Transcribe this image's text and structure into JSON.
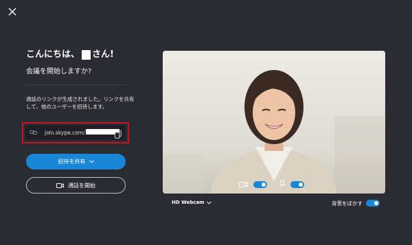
{
  "window": {
    "close_icon": "close-icon"
  },
  "greeting": {
    "prefix": "こんにちは、",
    "suffix": "さん!"
  },
  "subtitle": "会議を開始しますか?",
  "link_info": "通話のリンクが生成されました。リンクを共有して、他のユーザーを招待します。",
  "meeting_link": {
    "text": "join.skype.com/"
  },
  "buttons": {
    "invite": "招待を共有",
    "start_call": "通話を開始"
  },
  "video": {
    "camera_toggle": true,
    "mic_toggle": true
  },
  "camera_select": {
    "selected": "HD Webcam"
  },
  "background_blur": {
    "label": "背景をぼかす",
    "enabled": true
  },
  "colors": {
    "accent": "#1a86d6",
    "background": "#2b2c33",
    "highlight": "#c4161c"
  }
}
